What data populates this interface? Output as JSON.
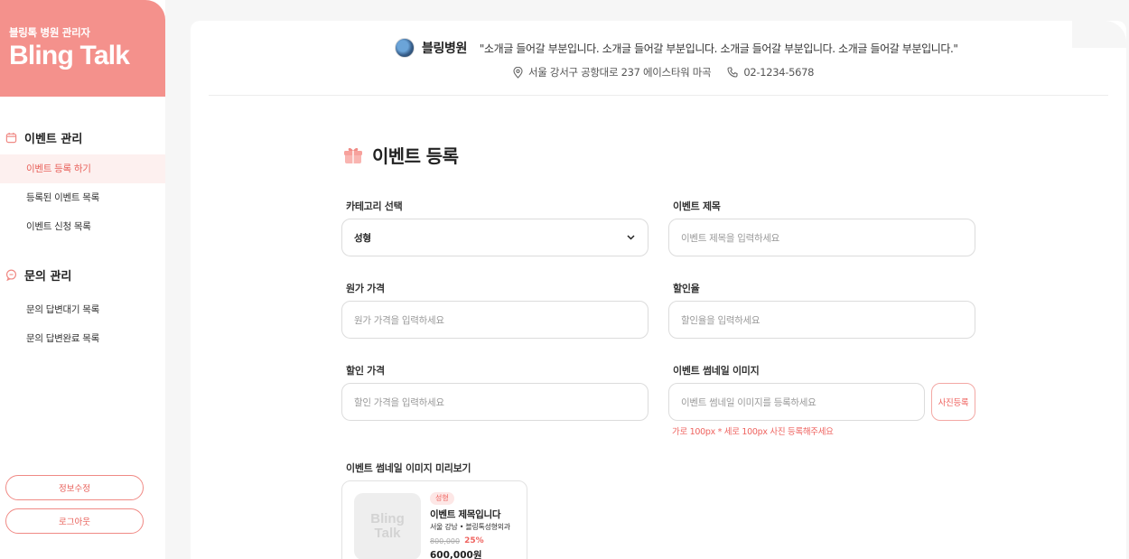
{
  "brand": {
    "subtitle": "블링톡 병원 관리자",
    "title": "Bling Talk"
  },
  "sidebar": {
    "groups": [
      {
        "label": "이벤트 관리",
        "icon": "calendar-icon",
        "items": [
          {
            "label": "이벤트 등록 하기",
            "active": true
          },
          {
            "label": "등록된 이벤트 목록",
            "active": false
          },
          {
            "label": "이벤트 신청 목록",
            "active": false
          }
        ]
      },
      {
        "label": "문의 관리",
        "icon": "chat-bubble-icon",
        "items": [
          {
            "label": "문의 답변대기 목록",
            "active": false
          },
          {
            "label": "문의 답변완료 목록",
            "active": false
          }
        ]
      }
    ],
    "edit_profile": "정보수정",
    "logout": "로그아웃"
  },
  "header": {
    "hospital_name": "블링병원",
    "intro": "\"소개글 들어갈 부분입니다. 소개글 들어갈 부분입니다. 소개글 들어갈 부분입니다. 소개글 들어갈 부분입니다.\"",
    "address": "서울 강서구 공항대로 237 에이스타워 마곡",
    "phone": "02-1234-5678"
  },
  "page": {
    "title": "이벤트 등록",
    "title_icon": "gift-icon"
  },
  "form": {
    "category": {
      "label": "카테고리 선택",
      "value": "성형"
    },
    "event_title": {
      "label": "이벤트 제목",
      "placeholder": "이벤트 제목을 입력하세요"
    },
    "original_price": {
      "label": "원가 가격",
      "placeholder": "원가 가격을 입력하세요"
    },
    "discount_rate": {
      "label": "할인율",
      "placeholder": "할인율을 입력하세요"
    },
    "discount_price": {
      "label": "할인 가격",
      "placeholder": "할인 가격을 입력하세요"
    },
    "thumbnail": {
      "label": "이벤트 썸네일 이미지",
      "placeholder": "이벤트 썸네일 이미지를 등록하세요",
      "button": "사진등록",
      "hint": "가로 100px * 세로 100px 사진 등록해주세요"
    },
    "preview": {
      "label": "이벤트 썸네일 이미지 미리보기",
      "thumb_text_1": "Bling",
      "thumb_text_2": "Talk",
      "badge": "성형",
      "title": "이벤트 제목입니다",
      "location": "서울 강남 • 블링톡성형외과",
      "original_price": "800,000",
      "discount_rate": "25%",
      "final_price": "600,000원"
    }
  },
  "colors": {
    "accent": "#f4918c",
    "accent_text": "#ef6460"
  }
}
